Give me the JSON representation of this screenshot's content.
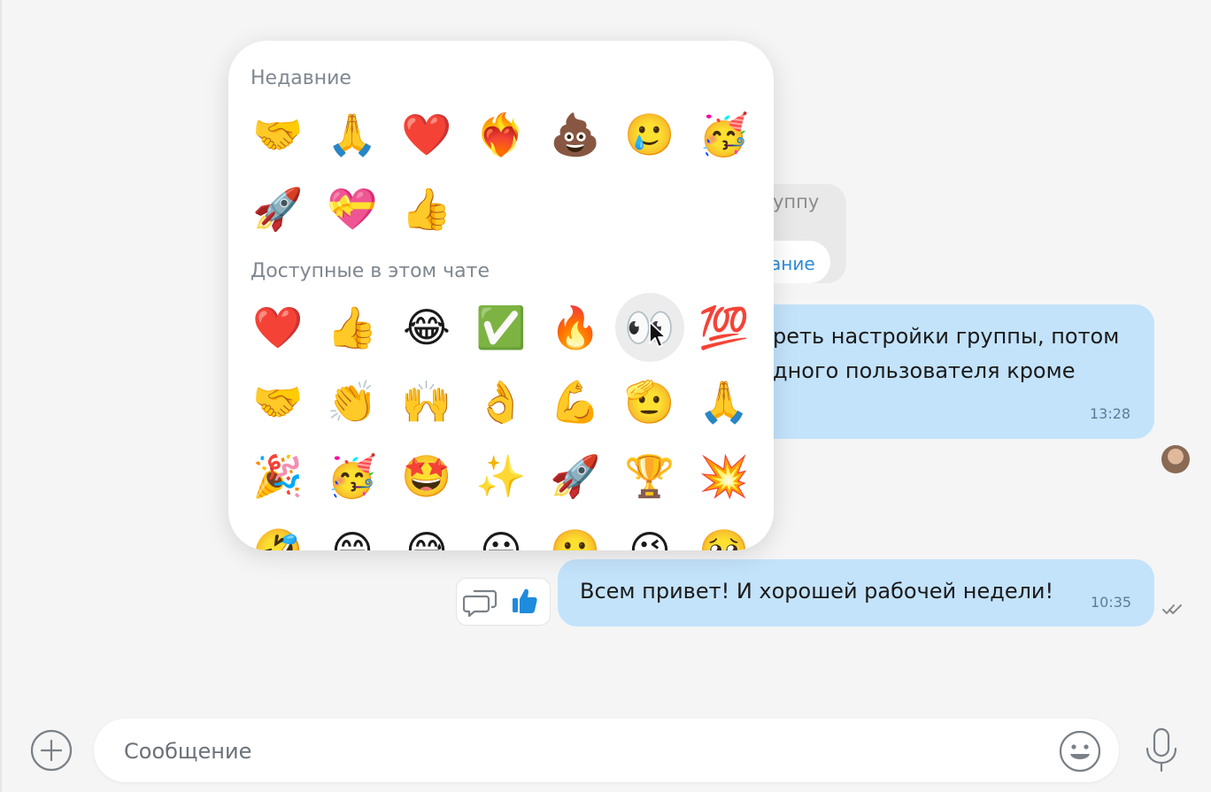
{
  "messages": {
    "gray_partial_text": "уппу",
    "gray_partial_button": "ание",
    "blue1_line1": "реть настройки группы, потом",
    "blue1_line2": "дного пользователя кроме",
    "blue1_time": "13:28",
    "blue2_text": "Всем привет! И хорошей рабочей недели!",
    "blue2_time": "10:35"
  },
  "picker": {
    "recent_title": "Недавние",
    "recent": [
      "🤝",
      "🙏",
      "❤️",
      "❤️‍🔥",
      "💩",
      "🥲",
      "🥳",
      "🚀",
      "💝",
      "👍"
    ],
    "available_title": "Доступные в этом чате",
    "available": [
      "❤️",
      "👍",
      "😂",
      "✅",
      "🔥",
      "👀",
      "💯",
      "🤝",
      "👏",
      "🙌",
      "👌",
      "💪",
      "🫡",
      "🙏",
      "🎉",
      "🥳",
      "🤩",
      "✨",
      "🚀",
      "🏆",
      "💥",
      "🤣",
      "😁",
      "😅",
      "😀",
      "🙂",
      "😉",
      "🥹"
    ],
    "hovered_index": 5
  },
  "composer": {
    "placeholder": "Сообщение"
  },
  "colors": {
    "bubble_blue": "#c3e3fb",
    "accent_blue": "#2e8ad8",
    "like_blue": "#1f8bdc"
  }
}
